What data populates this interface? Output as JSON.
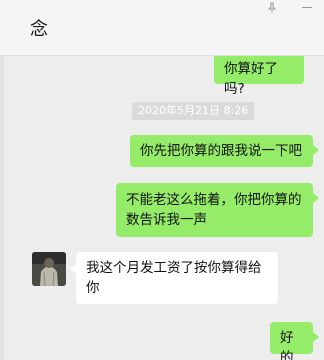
{
  "header": {
    "contact_name": "念"
  },
  "messages": [
    {
      "from": "me",
      "text": "你算好了吗?"
    },
    {
      "from": "me",
      "text": "你先把你算的跟我说一下吧"
    },
    {
      "from": "me",
      "text": "不能老这么拖着，你把你算的数告诉我一声"
    },
    {
      "from": "them",
      "text": "我这个月发工资了按你算得给你"
    },
    {
      "from": "me",
      "text": "好的"
    }
  ],
  "timestamp": "2020年5月21日 8:26",
  "colors": {
    "my_bubble": "#95ec69",
    "their_bubble": "#ffffff",
    "background": "#ededed"
  }
}
